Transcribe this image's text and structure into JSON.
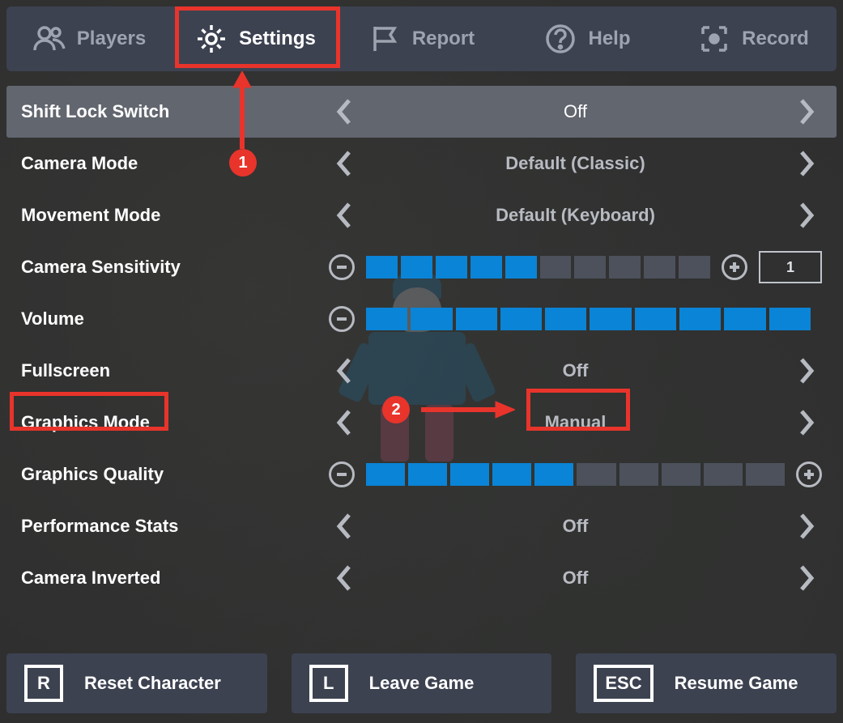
{
  "tabs": {
    "players": {
      "label": "Players",
      "icon": "players-icon"
    },
    "settings": {
      "label": "Settings",
      "icon": "gear-icon",
      "active": true
    },
    "report": {
      "label": "Report",
      "icon": "flag-icon"
    },
    "help": {
      "label": "Help",
      "icon": "help-icon"
    },
    "record": {
      "label": "Record",
      "icon": "record-icon"
    }
  },
  "settings": {
    "shift_lock_switch": {
      "label": "Shift Lock Switch",
      "value": "Off",
      "highlight": true
    },
    "camera_mode": {
      "label": "Camera Mode",
      "value": "Default (Classic)"
    },
    "movement_mode": {
      "label": "Movement Mode",
      "value": "Default (Keyboard)"
    },
    "camera_sensitivity": {
      "label": "Camera Sensitivity",
      "filled": 5,
      "total": 10,
      "number": "1"
    },
    "volume": {
      "label": "Volume",
      "filled": 10,
      "total": 10
    },
    "fullscreen": {
      "label": "Fullscreen",
      "value": "Off"
    },
    "graphics_mode": {
      "label": "Graphics Mode",
      "value": "Manual"
    },
    "graphics_quality": {
      "label": "Graphics Quality",
      "filled": 5,
      "total": 10
    },
    "performance_stats": {
      "label": "Performance Stats",
      "value": "Off"
    },
    "camera_inverted": {
      "label": "Camera Inverted",
      "value": "Off"
    }
  },
  "bottom": {
    "reset": {
      "key": "R",
      "label": "Reset Character"
    },
    "leave": {
      "key": "L",
      "label": "Leave Game"
    },
    "resume": {
      "key": "ESC",
      "label": "Resume Game"
    }
  },
  "annotations": {
    "badge1": "1",
    "badge2": "2"
  }
}
